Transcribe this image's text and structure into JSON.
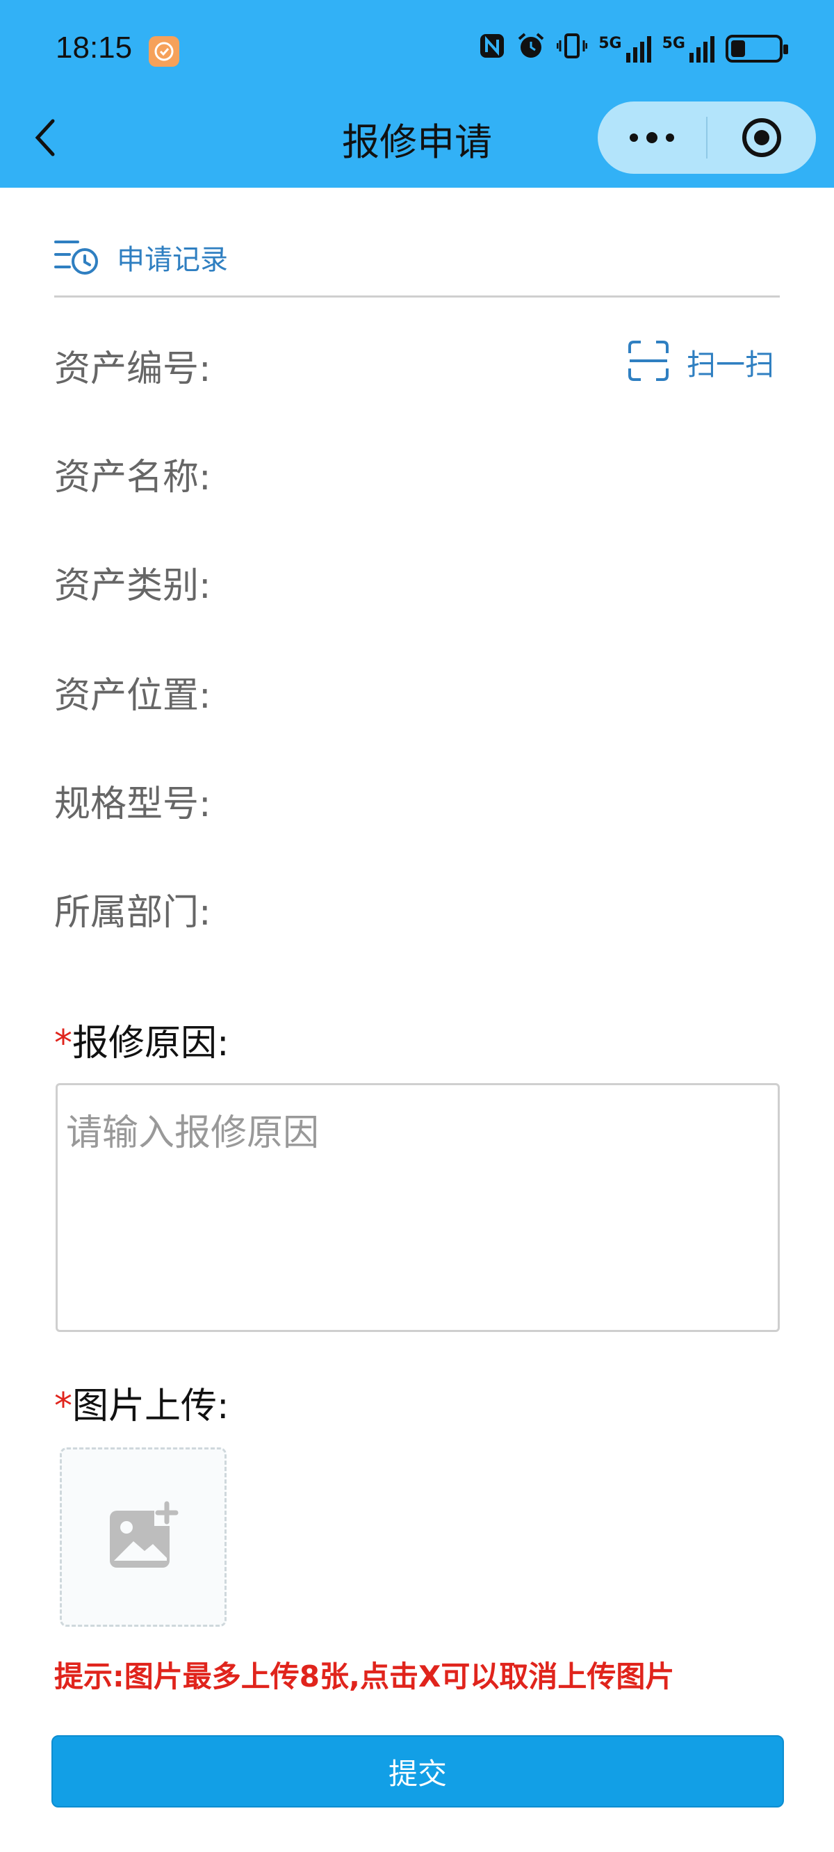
{
  "status_bar": {
    "time": "18:15",
    "app_icon": "heart-badge-icon",
    "icons": [
      "nfc-icon",
      "alarm-icon",
      "vibrate-icon"
    ],
    "signal1_label": "5G",
    "signal2_label": "5G",
    "battery_level": 0.3
  },
  "nav": {
    "title": "报修申请",
    "back_icon": "chevron-left-icon",
    "more_icon": "more-dots-icon",
    "close_icon": "target-circle-icon"
  },
  "records": {
    "label": "申请记录",
    "icon": "list-clock-icon"
  },
  "scan": {
    "label": "扫一扫",
    "icon": "scan-frame-icon"
  },
  "fields": [
    {
      "label": "资产编号:"
    },
    {
      "label": "资产名称:"
    },
    {
      "label": "资产类别:"
    },
    {
      "label": "资产位置:"
    },
    {
      "label": "规格型号:"
    },
    {
      "label": "所属部门:"
    }
  ],
  "reason": {
    "star": "*",
    "label": "报修原因:",
    "placeholder": "请输入报修原因"
  },
  "upload": {
    "star": "*",
    "label": "图片上传:",
    "icon": "add-image-icon"
  },
  "tip": "提示:图片最多上传8张,点击X可以取消上传图片",
  "submit_label": "提交",
  "colors": {
    "header": "#32b1f6",
    "accent_text": "#2f7fc1",
    "required": "#e0241c",
    "submit": "#129fe6"
  }
}
